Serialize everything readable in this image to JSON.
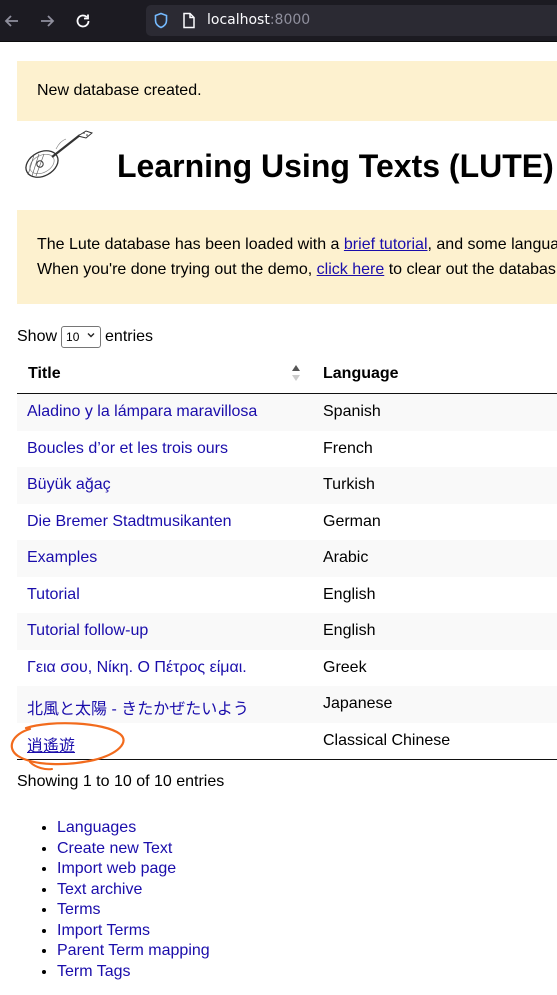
{
  "browser": {
    "url_host": "localhost",
    "url_port": ":8000"
  },
  "flash_message": "New database created.",
  "page_title": "Learning Using Texts (LUTE)",
  "notice": {
    "line1_prefix": "The Lute database has been loaded with a ",
    "line1_link": "brief tutorial",
    "line1_suffix": ", and some langua",
    "line2_prefix": "When you're done trying out the demo, ",
    "line2_link": "click here",
    "line2_suffix": " to clear out the databas"
  },
  "entries_control": {
    "prefix": "Show",
    "selected": "10",
    "suffix": "entries"
  },
  "table": {
    "headers": {
      "title": "Title",
      "language": "Language"
    },
    "rows": [
      {
        "title": "Aladino y la lámpara maravillosa",
        "language": "Spanish"
      },
      {
        "title": "Boucles d’or et les trois ours",
        "language": "French"
      },
      {
        "title": "Büyük ağaç",
        "language": "Turkish"
      },
      {
        "title": "Die Bremer Stadtmusikanten",
        "language": "German"
      },
      {
        "title": "Examples",
        "language": "Arabic"
      },
      {
        "title": "Tutorial",
        "language": "English"
      },
      {
        "title": "Tutorial follow-up",
        "language": "English"
      },
      {
        "title": "Γεια σου, Νίκη. Ο Πέτρος είμαι.",
        "language": "Greek"
      },
      {
        "title": "北風と太陽 - きたかぜたいよう",
        "language": "Japanese"
      },
      {
        "title": "逍遙遊",
        "language": "Classical Chinese"
      }
    ]
  },
  "table_info": "Showing 1 to 10 of 10 entries",
  "menu": [
    "Languages",
    "Create new Text",
    "Import web page",
    "Text archive",
    "Terms",
    "Import Terms",
    "Parent Term mapping",
    "Term Tags"
  ],
  "colors": {
    "link": "#1a0dab",
    "notice_bg": "#fdf1cf",
    "annotation": "#f26b1d",
    "chrome_bg": "#1c1b22"
  }
}
